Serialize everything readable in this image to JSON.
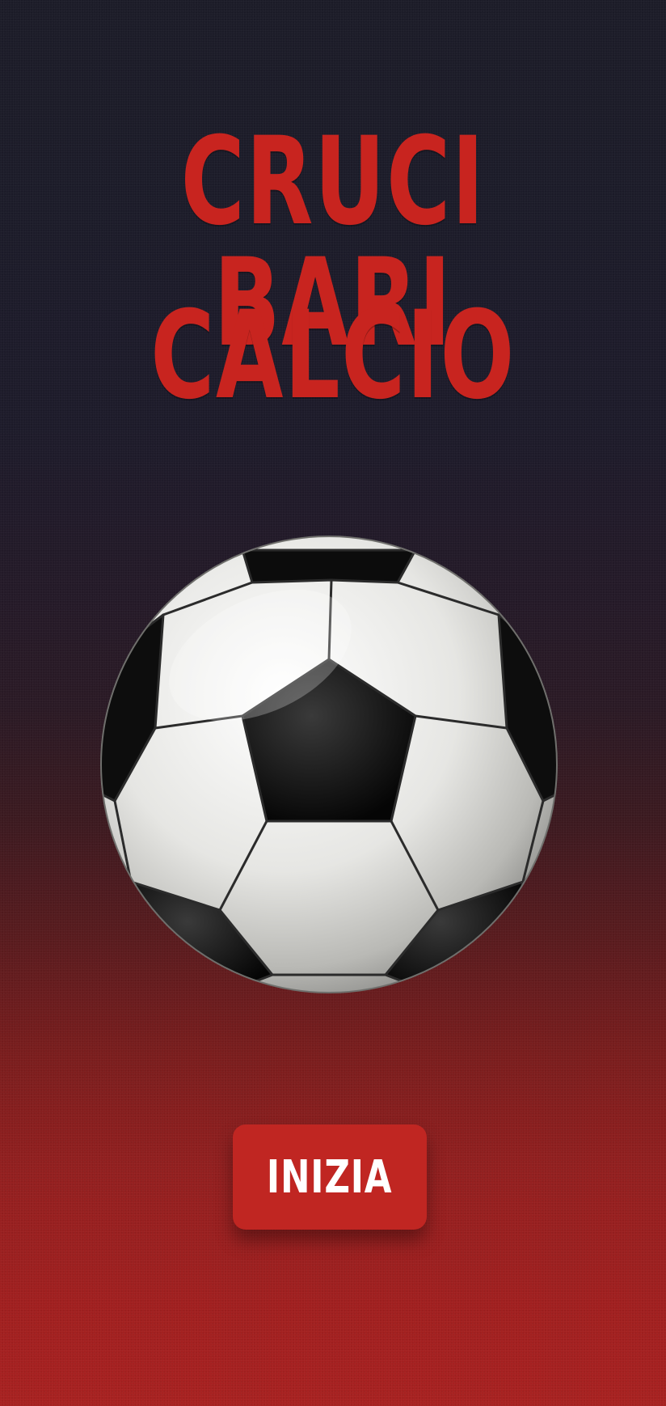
{
  "screen": {
    "title_line1": "CRUCI BARI",
    "title_line2": "CALCIO",
    "start_button_label": "INIZIA"
  },
  "colors": {
    "title": "#c8241f",
    "button": "#c02622",
    "background_top": "#1c1c28",
    "background_bottom": "#a82120"
  },
  "icons": {
    "ball": "soccer-ball-icon"
  }
}
